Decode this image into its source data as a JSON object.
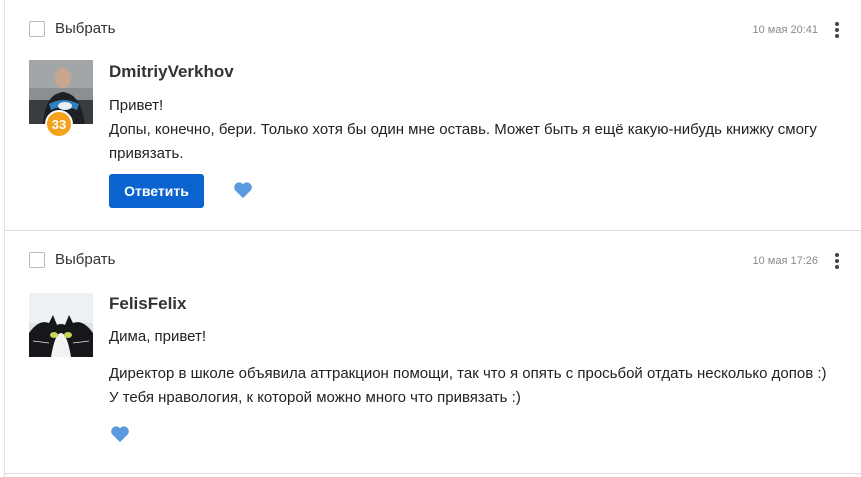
{
  "colors": {
    "accent": "#0a63cf",
    "badge": "#f4a11b",
    "heart": "#5a9be0"
  },
  "messages": [
    {
      "select_label": "Выбрать",
      "date": "10 мая 20:41",
      "author": "DmitriyVerkhov",
      "level": "33",
      "lines": [
        "Привет!",
        "Допы, конечно, бери. Только хотя бы один мне оставь. Может быть я ещё какую-нибудь книжку смогу привязать."
      ],
      "reply_label": "Ответить",
      "like_icon": "heart-icon"
    },
    {
      "select_label": "Выбрать",
      "date": "10 мая 17:26",
      "author": "FelisFelix",
      "lines": [
        "Дима, привет!",
        "Директор в школе объявила аттракцион помощи, так что я опять с просьбой отдать несколько допов :)",
        "У тебя нравология, к которой можно много что привязать :)"
      ],
      "like_icon": "heart-icon"
    }
  ]
}
